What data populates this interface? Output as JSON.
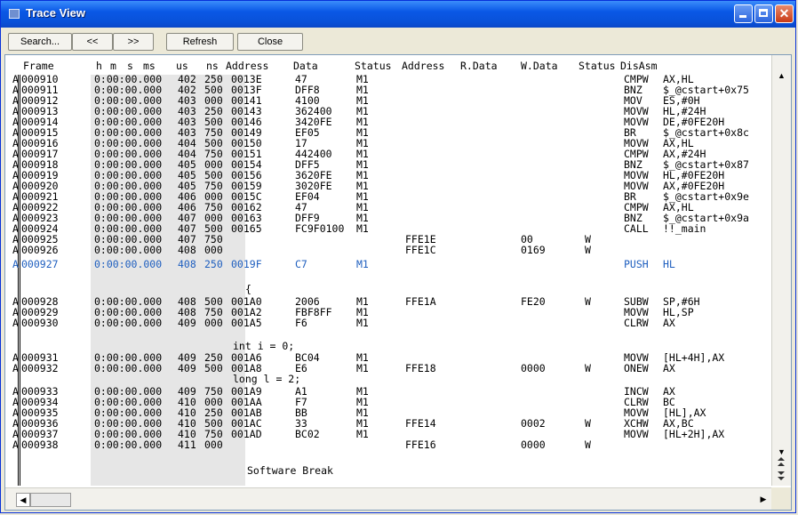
{
  "window": {
    "title": "Trace View"
  },
  "toolbar": {
    "search": "Search...",
    "prev": "<<",
    "next": ">>",
    "refresh": "Refresh",
    "close": "Close"
  },
  "columns": {
    "frame": "Frame",
    "h": "h",
    "m": "m",
    "s": "s",
    "ms": "ms",
    "us": "us",
    "ns": "ns",
    "address": "Address",
    "data": "Data",
    "status": "Status",
    "raddress": "Address",
    "rdata": "R.Data",
    "wdata": "W.Data",
    "status2": "Status",
    "disasm": "DisAsm"
  },
  "rows": [
    {
      "flag": "A",
      "frame": "000910",
      "time": "0:00:00.000",
      "us": "402",
      "ns": "250",
      "address": "0013E",
      "data": "47",
      "status": "M1",
      "raddr": "",
      "rdata": "",
      "wdata": "",
      "wstatus": "",
      "mn": "CMPW",
      "op": "AX,HL"
    },
    {
      "flag": "A",
      "frame": "000911",
      "time": "0:00:00.000",
      "us": "402",
      "ns": "500",
      "address": "0013F",
      "data": "DFF8",
      "status": "M1",
      "raddr": "",
      "rdata": "",
      "wdata": "",
      "wstatus": "",
      "mn": "BNZ",
      "op": "$_@cstart+0x75"
    },
    {
      "flag": "A",
      "frame": "000912",
      "time": "0:00:00.000",
      "us": "403",
      "ns": "000",
      "address": "00141",
      "data": "4100",
      "status": "M1",
      "raddr": "",
      "rdata": "",
      "wdata": "",
      "wstatus": "",
      "mn": "MOV",
      "op": "ES,#0H"
    },
    {
      "flag": "A",
      "frame": "000913",
      "time": "0:00:00.000",
      "us": "403",
      "ns": "250",
      "address": "00143",
      "data": "362400",
      "status": "M1",
      "raddr": "",
      "rdata": "",
      "wdata": "",
      "wstatus": "",
      "mn": "MOVW",
      "op": "HL,#24H"
    },
    {
      "flag": "A",
      "frame": "000914",
      "time": "0:00:00.000",
      "us": "403",
      "ns": "500",
      "address": "00146",
      "data": "3420FE",
      "status": "M1",
      "raddr": "",
      "rdata": "",
      "wdata": "",
      "wstatus": "",
      "mn": "MOVW",
      "op": "DE,#0FE20H"
    },
    {
      "flag": "A",
      "frame": "000915",
      "time": "0:00:00.000",
      "us": "403",
      "ns": "750",
      "address": "00149",
      "data": "EF05",
      "status": "M1",
      "raddr": "",
      "rdata": "",
      "wdata": "",
      "wstatus": "",
      "mn": "BR",
      "op": "$_@cstart+0x8c"
    },
    {
      "flag": "A",
      "frame": "000916",
      "time": "0:00:00.000",
      "us": "404",
      "ns": "500",
      "address": "00150",
      "data": "17",
      "status": "M1",
      "raddr": "",
      "rdata": "",
      "wdata": "",
      "wstatus": "",
      "mn": "MOVW",
      "op": "AX,HL"
    },
    {
      "flag": "A",
      "frame": "000917",
      "time": "0:00:00.000",
      "us": "404",
      "ns": "750",
      "address": "00151",
      "data": "442400",
      "status": "M1",
      "raddr": "",
      "rdata": "",
      "wdata": "",
      "wstatus": "",
      "mn": "CMPW",
      "op": "AX,#24H"
    },
    {
      "flag": "A",
      "frame": "000918",
      "time": "0:00:00.000",
      "us": "405",
      "ns": "000",
      "address": "00154",
      "data": "DFF5",
      "status": "M1",
      "raddr": "",
      "rdata": "",
      "wdata": "",
      "wstatus": "",
      "mn": "BNZ",
      "op": "$_@cstart+0x87"
    },
    {
      "flag": "A",
      "frame": "000919",
      "time": "0:00:00.000",
      "us": "405",
      "ns": "500",
      "address": "00156",
      "data": "3620FE",
      "status": "M1",
      "raddr": "",
      "rdata": "",
      "wdata": "",
      "wstatus": "",
      "mn": "MOVW",
      "op": "HL,#0FE20H"
    },
    {
      "flag": "A",
      "frame": "000920",
      "time": "0:00:00.000",
      "us": "405",
      "ns": "750",
      "address": "00159",
      "data": "3020FE",
      "status": "M1",
      "raddr": "",
      "rdata": "",
      "wdata": "",
      "wstatus": "",
      "mn": "MOVW",
      "op": "AX,#0FE20H"
    },
    {
      "flag": "A",
      "frame": "000921",
      "time": "0:00:00.000",
      "us": "406",
      "ns": "000",
      "address": "0015C",
      "data": "EF04",
      "status": "M1",
      "raddr": "",
      "rdata": "",
      "wdata": "",
      "wstatus": "",
      "mn": "BR",
      "op": "$_@cstart+0x9e"
    },
    {
      "flag": "A",
      "frame": "000922",
      "time": "0:00:00.000",
      "us": "406",
      "ns": "750",
      "address": "00162",
      "data": "47",
      "status": "M1",
      "raddr": "",
      "rdata": "",
      "wdata": "",
      "wstatus": "",
      "mn": "CMPW",
      "op": "AX,HL"
    },
    {
      "flag": "A",
      "frame": "000923",
      "time": "0:00:00.000",
      "us": "407",
      "ns": "000",
      "address": "00163",
      "data": "DFF9",
      "status": "M1",
      "raddr": "",
      "rdata": "",
      "wdata": "",
      "wstatus": "",
      "mn": "BNZ",
      "op": "$_@cstart+0x9a"
    },
    {
      "flag": "A",
      "frame": "000924",
      "time": "0:00:00.000",
      "us": "407",
      "ns": "500",
      "address": "00165",
      "data": "FC9F0100",
      "status": "M1",
      "raddr": "",
      "rdata": "",
      "wdata": "",
      "wstatus": "",
      "mn": "CALL",
      "op": "!!_main"
    },
    {
      "flag": "A",
      "frame": "000925",
      "time": "0:00:00.000",
      "us": "407",
      "ns": "750",
      "address": "",
      "data": "",
      "status": "",
      "raddr": "FFE1E",
      "rdata": "",
      "wdata": "00",
      "wstatus": "W",
      "mn": "",
      "op": ""
    },
    {
      "flag": "A",
      "frame": "000926",
      "time": "0:00:00.000",
      "us": "408",
      "ns": "000",
      "address": "",
      "data": "",
      "status": "",
      "raddr": "FFE1C",
      "rdata": "",
      "wdata": "0169",
      "wstatus": "W",
      "mn": "",
      "op": ""
    },
    {
      "flag": "A",
      "frame": "000927",
      "time": "0:00:00.000",
      "us": "408",
      "ns": "250",
      "address": "0019F",
      "data": "C7",
      "status": "M1",
      "raddr": "",
      "rdata": "",
      "wdata": "",
      "wstatus": "",
      "mn": "PUSH",
      "op": "HL",
      "hl": true
    },
    {
      "flag": "A",
      "frame": "000928",
      "time": "0:00:00.000",
      "us": "408",
      "ns": "500",
      "address": "001A0",
      "data": "2006",
      "status": "M1",
      "raddr": "FFE1A",
      "rdata": "",
      "wdata": "FE20",
      "wstatus": "W",
      "mn": "SUBW",
      "op": "SP,#6H"
    },
    {
      "flag": "A",
      "frame": "000929",
      "time": "0:00:00.000",
      "us": "408",
      "ns": "750",
      "address": "001A2",
      "data": "FBF8FF",
      "status": "M1",
      "raddr": "",
      "rdata": "",
      "wdata": "",
      "wstatus": "",
      "mn": "MOVW",
      "op": "HL,SP"
    },
    {
      "flag": "A",
      "frame": "000930",
      "time": "0:00:00.000",
      "us": "409",
      "ns": "000",
      "address": "001A5",
      "data": "F6",
      "status": "M1",
      "raddr": "",
      "rdata": "",
      "wdata": "",
      "wstatus": "",
      "mn": "CLRW",
      "op": "AX"
    },
    {
      "flag": "A",
      "frame": "000931",
      "time": "0:00:00.000",
      "us": "409",
      "ns": "250",
      "address": "001A6",
      "data": "BC04",
      "status": "M1",
      "raddr": "",
      "rdata": "",
      "wdata": "",
      "wstatus": "",
      "mn": "MOVW",
      "op": "[HL+4H],AX"
    },
    {
      "flag": "A",
      "frame": "000932",
      "time": "0:00:00.000",
      "us": "409",
      "ns": "500",
      "address": "001A8",
      "data": "E6",
      "status": "M1",
      "raddr": "FFE18",
      "rdata": "",
      "wdata": "0000",
      "wstatus": "W",
      "mn": "ONEW",
      "op": "AX"
    },
    {
      "flag": "A",
      "frame": "000933",
      "time": "0:00:00.000",
      "us": "409",
      "ns": "750",
      "address": "001A9",
      "data": "A1",
      "status": "M1",
      "raddr": "",
      "rdata": "",
      "wdata": "",
      "wstatus": "",
      "mn": "INCW",
      "op": "AX"
    },
    {
      "flag": "A",
      "frame": "000934",
      "time": "0:00:00.000",
      "us": "410",
      "ns": "000",
      "address": "001AA",
      "data": "F7",
      "status": "M1",
      "raddr": "",
      "rdata": "",
      "wdata": "",
      "wstatus": "",
      "mn": "CLRW",
      "op": "BC"
    },
    {
      "flag": "A",
      "frame": "000935",
      "time": "0:00:00.000",
      "us": "410",
      "ns": "250",
      "address": "001AB",
      "data": "BB",
      "status": "M1",
      "raddr": "",
      "rdata": "",
      "wdata": "",
      "wstatus": "",
      "mn": "MOVW",
      "op": "[HL],AX"
    },
    {
      "flag": "A",
      "frame": "000936",
      "time": "0:00:00.000",
      "us": "410",
      "ns": "500",
      "address": "001AC",
      "data": "33",
      "status": "M1",
      "raddr": "FFE14",
      "rdata": "",
      "wdata": "0002",
      "wstatus": "W",
      "mn": "XCHW",
      "op": "AX,BC"
    },
    {
      "flag": "A",
      "frame": "000937",
      "time": "0:00:00.000",
      "us": "410",
      "ns": "750",
      "address": "001AD",
      "data": "BC02",
      "status": "M1",
      "raddr": "",
      "rdata": "",
      "wdata": "",
      "wstatus": "",
      "mn": "MOVW",
      "op": "[HL+2H],AX"
    },
    {
      "flag": "A",
      "frame": "000938",
      "time": "0:00:00.000",
      "us": "411",
      "ns": "000",
      "address": "",
      "data": "",
      "status": "",
      "raddr": "FFE16",
      "rdata": "",
      "wdata": "0000",
      "wstatus": "W",
      "mn": "",
      "op": ""
    }
  ],
  "source_lines": {
    "brace": "{",
    "int_i": "int i = 0;",
    "long_l": "long l = 2;",
    "software_break": "Software Break"
  },
  "colors": {
    "titlebar": "#0a58e6",
    "highlight_text": "#1f5fbf",
    "time_bg": "#e6e6e6"
  }
}
